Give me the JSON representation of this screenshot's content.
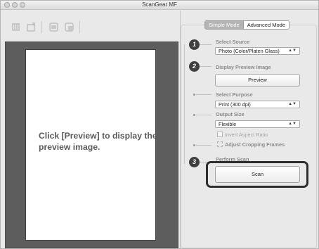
{
  "window": {
    "title": "ScanGear MF"
  },
  "toolbar": {
    "icons": [
      "rotate-left-icon",
      "crop-icon",
      "zoom-icon",
      "scan-window-icon"
    ]
  },
  "preview": {
    "message": "Click [Preview] to display the preview image."
  },
  "mode_tabs": {
    "simple": "Simple Mode",
    "advanced": "Advanced Mode",
    "active": "Simple Mode"
  },
  "steps": {
    "one": "1",
    "two": "2",
    "three": "3"
  },
  "select_source": {
    "label": "Select Source",
    "value": "Photo (Color/Platen Glass)"
  },
  "display_preview": {
    "label": "Display Preview Image",
    "button": "Preview"
  },
  "select_purpose": {
    "label": "Select Purpose",
    "value": "Print (300 dpi)"
  },
  "output_size": {
    "label": "Output Size",
    "value": "Flexible",
    "invert_label": "Invert Aspect Ratio",
    "adjust_label": "Adjust Cropping Frames"
  },
  "perform_scan": {
    "label": "Perform Scan",
    "button": "Scan"
  }
}
